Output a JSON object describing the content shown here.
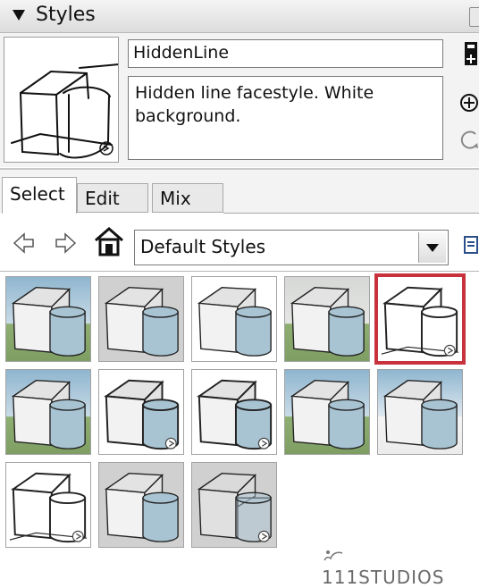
{
  "panel": {
    "title": "Styles",
    "expand_icon": "triangle-down-icon"
  },
  "style_info": {
    "name": "HiddenLine",
    "description": "Hidden line facestyle. White background."
  },
  "side_buttons": [
    "create-new-style-icon",
    "add-style-icon",
    "update-style-icon"
  ],
  "tabs": [
    {
      "label": "Select",
      "active": true
    },
    {
      "label": "Edit",
      "active": false
    },
    {
      "label": "Mix",
      "active": false
    }
  ],
  "nav": {
    "back_icon": "arrow-left-icon",
    "forward_icon": "arrow-right-icon",
    "home_icon": "home-icon",
    "collection": "Default Styles",
    "details_icon": "details-icon"
  },
  "styles_grid": [
    {
      "id": "style-1",
      "background": "sky-green",
      "shading": "shaded",
      "selected": false
    },
    {
      "id": "style-2",
      "background": "gray",
      "shading": "shaded",
      "selected": false
    },
    {
      "id": "style-3",
      "background": "white",
      "shading": "shaded",
      "selected": false
    },
    {
      "id": "style-4",
      "background": "gray-green",
      "shading": "shaded",
      "selected": false
    },
    {
      "id": "style-5",
      "background": "white",
      "shading": "hiddenline",
      "selected": true
    },
    {
      "id": "style-6",
      "background": "sky-green",
      "shading": "shaded",
      "selected": false
    },
    {
      "id": "style-7",
      "background": "white",
      "shading": "shaded-sketch",
      "selected": false
    },
    {
      "id": "style-8",
      "background": "white",
      "shading": "shaded-sketch",
      "selected": false
    },
    {
      "id": "style-9",
      "background": "sky-green",
      "shading": "shaded",
      "selected": false
    },
    {
      "id": "style-10",
      "background": "sky-white",
      "shading": "shaded",
      "selected": false
    },
    {
      "id": "style-11",
      "background": "white",
      "shading": "wireframe-sketch",
      "selected": false
    },
    {
      "id": "style-12",
      "background": "gray",
      "shading": "shaded",
      "selected": false
    },
    {
      "id": "style-13",
      "background": "gray",
      "shading": "xray",
      "selected": false
    }
  ],
  "watermark": "111STUDIOS",
  "colors": {
    "selection": "#c8323c",
    "cylinder": "#a8c3d2",
    "sky": "#8fb6cf",
    "ground": "#8fae72"
  }
}
